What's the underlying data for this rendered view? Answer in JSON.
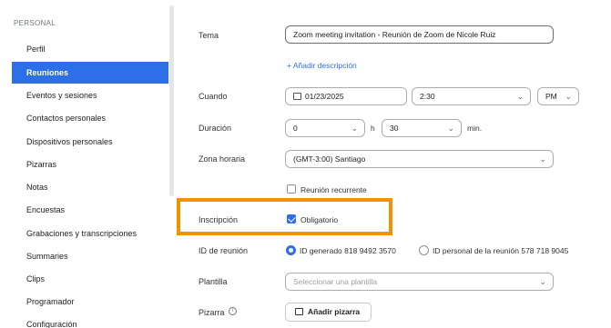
{
  "sidebar": {
    "section": "PERSONAL",
    "items": [
      {
        "label": "Perfil"
      },
      {
        "label": "Reuniones",
        "active": true
      },
      {
        "label": "Eventos y sesiones"
      },
      {
        "label": "Contactos personales"
      },
      {
        "label": "Dispositivos personales"
      },
      {
        "label": "Pizarras"
      },
      {
        "label": "Notas"
      },
      {
        "label": "Encuestas"
      },
      {
        "label": "Grabaciones y transcripciones"
      },
      {
        "label": "Summaries"
      },
      {
        "label": "Clips"
      },
      {
        "label": "Programador"
      },
      {
        "label": "Configuración"
      }
    ]
  },
  "form": {
    "topic": {
      "label": "Tema",
      "value": "Zoom meeting invitation - Reunión de Zoom de Nicole Ruiz"
    },
    "add_description": "+ Añadir descripción",
    "when": {
      "label": "Cuando",
      "date": "01/23/2025",
      "time": "2:30",
      "ampm": "PM"
    },
    "duration": {
      "label": "Duración",
      "hours": "0",
      "hours_unit": "h",
      "minutes": "30",
      "minutes_unit": "min."
    },
    "timezone": {
      "label": "Zona horaria",
      "value": "(GMT-3:00) Santiago"
    },
    "recurring": {
      "label": "Reunión recurrente",
      "checked": false
    },
    "registration": {
      "label": "Inscripción",
      "option": "Obligatorio",
      "checked": true
    },
    "meeting_id": {
      "label": "ID de reunión",
      "generated": "ID generado 818 9492 3570",
      "personal": "ID personal de la reunión 578 718 9045",
      "selected": "generated"
    },
    "template": {
      "label": "Plantilla",
      "placeholder": "Seleccionar una plantilla"
    },
    "whiteboard": {
      "label": "Pizarra",
      "button": "Añadir pizarra"
    }
  },
  "colors": {
    "accent": "#2d6fe6",
    "highlight": "#f39200"
  }
}
